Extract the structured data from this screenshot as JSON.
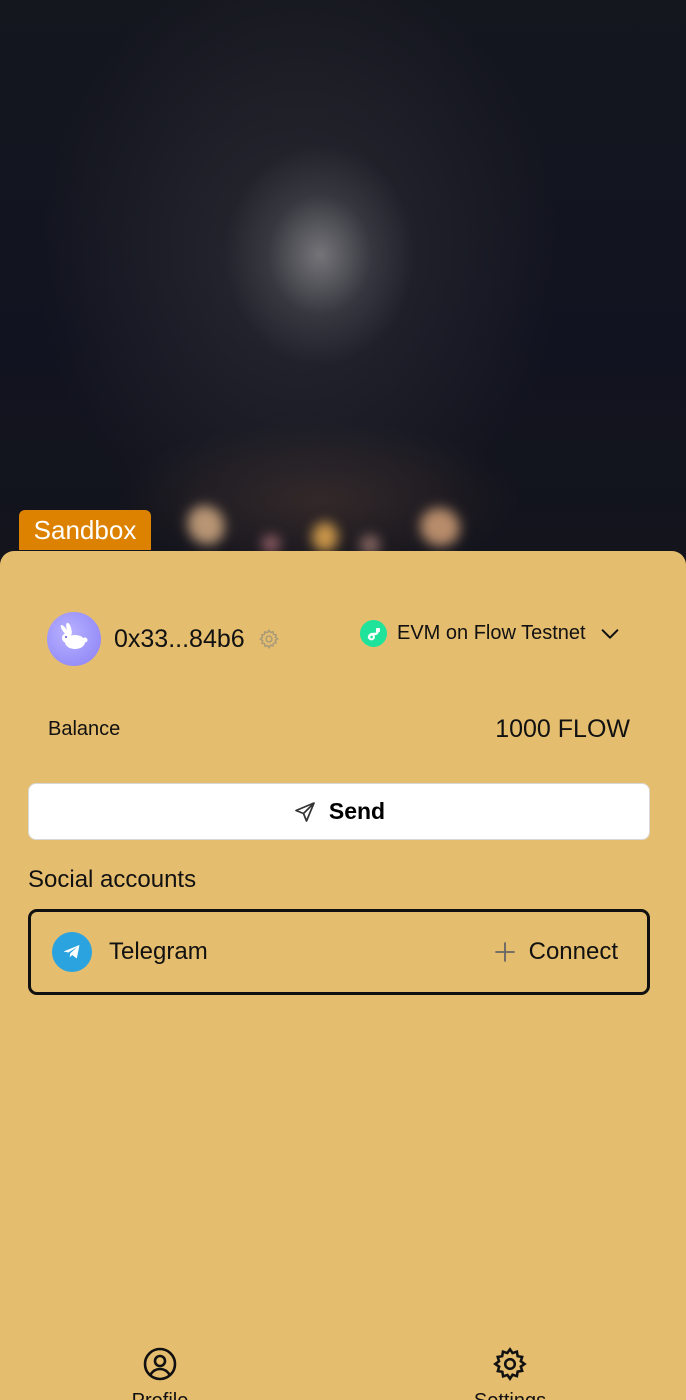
{
  "badge": {
    "label": "Sandbox"
  },
  "account": {
    "avatar_icon": "rabbit-avatar-icon",
    "address": "0x33...84b6",
    "settings_icon": "gear-icon"
  },
  "network": {
    "icon": "flow-network-icon",
    "label": "EVM on Flow Testnet",
    "dropdown_icon": "chevron-down-icon"
  },
  "balance": {
    "label": "Balance",
    "value": "1000 FLOW"
  },
  "send": {
    "icon": "send-icon",
    "label": "Send"
  },
  "social": {
    "title": "Social accounts",
    "accounts": [
      {
        "name": "Telegram",
        "icon": "telegram-icon",
        "action": "Connect",
        "action_icon": "plus-icon"
      }
    ]
  },
  "bottom_nav": [
    {
      "label": "Profile",
      "icon": "user-circle-icon"
    },
    {
      "label": "Settings",
      "icon": "gear-icon"
    }
  ],
  "colors": {
    "sheet": "#e5bd6f",
    "badge": "#dd8200",
    "telegram": "#2aa3df",
    "network": "#1fe39a"
  }
}
